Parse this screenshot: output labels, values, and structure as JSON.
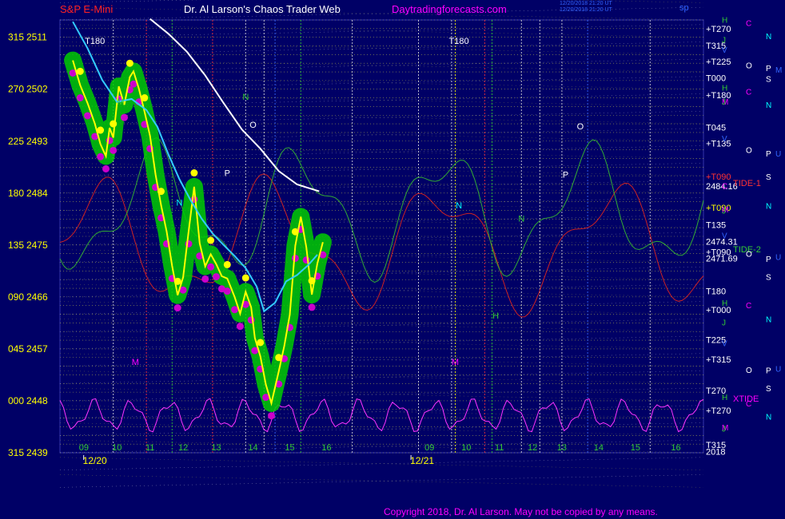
{
  "header": {
    "symbol": "S&P E-Mini",
    "site_title": "Dr. Al Larson's Chaos Trader Web",
    "site_url": "Daytradingforecasts.com",
    "timestamp_line1": "12/20/2018 21:20 UT",
    "timestamp_line2": "12/20/2018 21:20 UT",
    "sp_label": "sp            "
  },
  "copyright": "Copyright 2018, Dr. Al Larson. May not be copied by any means.",
  "colors": {
    "background": "#000066",
    "price_main": "#FFFF00",
    "price_glow": "#00CC00",
    "low_dots": "#CC00CC",
    "moving_avg": "#33CCFF",
    "white_line": "#FFFFFF",
    "green_line": "#33AA33",
    "red_line": "#CC2222",
    "magenta_line": "#FF33FF",
    "grid_yellow": "#CCCC44",
    "grid_white": "#DDDDDD",
    "text_yellow": "#FFFF00",
    "text_red": "#FF2222",
    "text_magenta": "#FF00FF",
    "text_cyan": "#00FFFF",
    "text_blue": "#3366FF",
    "text_green": "#33CC33"
  },
  "chart_data": {
    "type": "line",
    "title": "S&P E-Mini",
    "ylim": [
      2439,
      2514
    ],
    "y_ticks": [
      {
        "value": 2511,
        "angle": "315"
      },
      {
        "value": 2502,
        "angle": "270"
      },
      {
        "value": 2493,
        "angle": "225"
      },
      {
        "value": 2484,
        "angle": "180"
      },
      {
        "value": 2475,
        "angle": "135"
      },
      {
        "value": 2466,
        "angle": "090"
      },
      {
        "value": 2457,
        "angle": "045"
      },
      {
        "value": 2448,
        "angle": "000"
      },
      {
        "value": 2439,
        "angle": "315"
      }
    ],
    "x_hours": [
      "09",
      "10",
      "11",
      "12",
      "13",
      "14",
      "15",
      "16",
      "09",
      "10",
      "11",
      "12",
      "13",
      "14",
      "15",
      "16"
    ],
    "x_dates": [
      "12/20",
      "12/21"
    ],
    "right_labels": [
      {
        "text": "+T270",
        "price": 2512.5,
        "color": "#FFFFFF"
      },
      {
        "text": "T315",
        "price": 2509.6,
        "color": "#FFFFFF"
      },
      {
        "text": "+T225",
        "price": 2506.8,
        "color": "#FFFFFF"
      },
      {
        "text": "T000",
        "price": 2504.0,
        "color": "#FFFFFF"
      },
      {
        "text": "+T180",
        "price": 2501.0,
        "color": "#FFFFFF"
      },
      {
        "text": "T045",
        "price": 2495.4,
        "color": "#FFFFFF"
      },
      {
        "text": "+T135",
        "price": 2492.6,
        "color": "#FFFFFF"
      },
      {
        "text": "+T090",
        "price": 2486.9,
        "color": "#FF3333"
      },
      {
        "text": "2484.16",
        "price": 2485.2,
        "color": "#FFFFFF"
      },
      {
        "text": "+T090",
        "price": 2481.5,
        "color": "#FFFF00"
      },
      {
        "text": "T135",
        "price": 2478.5,
        "color": "#FFFFFF"
      },
      {
        "text": "2474.31",
        "price": 2475.6,
        "color": "#FFFFFF"
      },
      {
        "text": "+T090",
        "price": 2473.8,
        "color": "#FFFFFF"
      },
      {
        "text": "2471.69",
        "price": 2472.7,
        "color": "#FFFFFF"
      },
      {
        "text": "T180",
        "price": 2467.0,
        "color": "#FFFFFF"
      },
      {
        "text": "+T000",
        "price": 2463.8,
        "color": "#FFFFFF"
      },
      {
        "text": "T225",
        "price": 2458.6,
        "color": "#FFFFFF"
      },
      {
        "text": "+T315",
        "price": 2455.2,
        "color": "#FFFFFF"
      },
      {
        "text": "T270",
        "price": 2449.8,
        "color": "#FFFFFF"
      },
      {
        "text": "+T270",
        "price": 2446.3,
        "color": "#FFFFFF"
      },
      {
        "text": "T315",
        "price": 2440.4,
        "color": "#FFFFFF"
      },
      {
        "text": "2018",
        "price": 2439.2,
        "color": "#FFFFFF"
      }
    ],
    "tide_labels": [
      {
        "text": "TIDE-1",
        "price": 2485.8,
        "color": "#FF3333"
      },
      {
        "text": "TIDE-2",
        "price": 2474.3,
        "color": "#33CC33"
      },
      {
        "text": "XTIDE",
        "price": 2448.4,
        "color": "#FF00FF"
      }
    ],
    "planet_labels": [
      {
        "text": "H",
        "price": 2514.1,
        "color": "#33CC33",
        "col": 0
      },
      {
        "text": "C",
        "price": 2513.5,
        "color": "#FF00FF",
        "col": 1
      },
      {
        "text": "N",
        "price": 2511.2,
        "color": "#00FFFF",
        "col": 2
      },
      {
        "text": "J",
        "price": 2510.6,
        "color": "#33CC33",
        "col": 0
      },
      {
        "text": "V",
        "price": 2508.9,
        "color": "#3366FF",
        "col": 0
      },
      {
        "text": "O",
        "price": 2506.2,
        "color": "#FFFFFF",
        "col": 1
      },
      {
        "text": "P",
        "price": 2505.7,
        "color": "#FFFFFF",
        "col": 2
      },
      {
        "text": "M",
        "price": 2505.4,
        "color": "#3366FF",
        "col": 3
      },
      {
        "text": "S",
        "price": 2503.8,
        "color": "#FFFFFF",
        "col": 2
      },
      {
        "text": "H",
        "price": 2502.3,
        "color": "#33CC33",
        "col": 0
      },
      {
        "text": "C",
        "price": 2501.6,
        "color": "#FF00FF",
        "col": 1
      },
      {
        "text": "M",
        "price": 2499.9,
        "color": "#FF00FF",
        "col": 0
      },
      {
        "text": "J",
        "price": 2499.9,
        "color": "#33CC33",
        "col": 0
      },
      {
        "text": "N",
        "price": 2499.3,
        "color": "#00FFFF",
        "col": 2
      },
      {
        "text": "V",
        "price": 2493.5,
        "color": "#3366FF",
        "col": 0
      },
      {
        "text": "O",
        "price": 2491.5,
        "color": "#FFFFFF",
        "col": 1
      },
      {
        "text": "P",
        "price": 2490.9,
        "color": "#FFFFFF",
        "col": 2
      },
      {
        "text": "U",
        "price": 2490.9,
        "color": "#3366FF",
        "col": 3
      },
      {
        "text": "S",
        "price": 2486.9,
        "color": "#FFFFFF",
        "col": 2
      },
      {
        "text": "C",
        "price": 2485.3,
        "color": "#FF00FF",
        "col": 0
      },
      {
        "text": "N",
        "price": 2481.8,
        "color": "#00FFFF",
        "col": 2
      },
      {
        "text": "M",
        "price": 2481.2,
        "color": "#FF00FF",
        "col": 0
      },
      {
        "text": "J",
        "price": 2481.0,
        "color": "#33CC33",
        "col": 0
      },
      {
        "text": "V",
        "price": 2476.7,
        "color": "#3366FF",
        "col": 0
      },
      {
        "text": "O",
        "price": 2473.5,
        "color": "#FFFFFF",
        "col": 1
      },
      {
        "text": "U",
        "price": 2473.0,
        "color": "#3366FF",
        "col": 3
      },
      {
        "text": "P",
        "price": 2472.6,
        "color": "#FFFFFF",
        "col": 2
      },
      {
        "text": "S",
        "price": 2469.5,
        "color": "#FFFFFF",
        "col": 2
      },
      {
        "text": "H",
        "price": 2465.0,
        "color": "#33CC33",
        "col": 0
      },
      {
        "text": "C",
        "price": 2464.6,
        "color": "#FF00FF",
        "col": 1
      },
      {
        "text": "N",
        "price": 2462.2,
        "color": "#00FFFF",
        "col": 2
      },
      {
        "text": "J",
        "price": 2461.6,
        "color": "#33CC33",
        "col": 0
      },
      {
        "text": "V",
        "price": 2458.0,
        "color": "#3366FF",
        "col": 0
      },
      {
        "text": "O",
        "price": 2453.4,
        "color": "#FFFFFF",
        "col": 1
      },
      {
        "text": "P",
        "price": 2453.3,
        "color": "#FFFFFF",
        "col": 2
      },
      {
        "text": "U",
        "price": 2453.6,
        "color": "#3366FF",
        "col": 3
      },
      {
        "text": "S",
        "price": 2450.2,
        "color": "#FFFFFF",
        "col": 2
      },
      {
        "text": "H",
        "price": 2448.7,
        "color": "#33CC33",
        "col": 0
      },
      {
        "text": "C",
        "price": 2447.6,
        "color": "#FF00FF",
        "col": 1
      },
      {
        "text": "N",
        "price": 2445.3,
        "color": "#00FFFF",
        "col": 2
      },
      {
        "text": "M",
        "price": 2443.4,
        "color": "#FF00FF",
        "col": 0
      },
      {
        "text": "J",
        "price": 2443.2,
        "color": "#33CC33",
        "col": 0
      }
    ],
    "in_chart_labels": [
      {
        "text": "T180",
        "x": 9.5,
        "price": 2510.4,
        "color": "#FFFFFF"
      },
      {
        "text": "T180",
        "x": 19.4,
        "price": 2510.4,
        "color": "#FFFFFF"
      },
      {
        "text": "M",
        "x": 10.2,
        "price": 2499.9,
        "color": "#33CC33"
      },
      {
        "text": "N",
        "x": 11.8,
        "price": 2482.4,
        "color": "#00FFFF"
      },
      {
        "text": "N",
        "x": 13.6,
        "price": 2500.7,
        "color": "#33CC33"
      },
      {
        "text": "O",
        "x": 13.8,
        "price": 2495.9,
        "color": "#FFFFFF"
      },
      {
        "text": "P",
        "x": 13.1,
        "price": 2487.5,
        "color": "#FFFFFF"
      },
      {
        "text": "M",
        "x": 10.6,
        "price": 2454.8,
        "color": "#FF00FF"
      },
      {
        "text": "N",
        "x": 19.4,
        "price": 2481.9,
        "color": "#00FFFF"
      },
      {
        "text": "M",
        "x": 19.3,
        "price": 2454.8,
        "color": "#FF00FF"
      },
      {
        "text": "O",
        "x": 22.7,
        "price": 2495.6,
        "color": "#FFFFFF"
      },
      {
        "text": "P",
        "x": 22.3,
        "price": 2487.2,
        "color": "#FFFFFF"
      },
      {
        "text": "N",
        "x": 21.1,
        "price": 2479.6,
        "color": "#33CC33"
      },
      {
        "text": "H",
        "x": 20.4,
        "price": 2462.8,
        "color": "#33CC33"
      }
    ],
    "x_hour_positions": [
      9.2,
      10.1,
      11.0,
      11.9,
      12.8,
      13.8,
      14.8,
      15.8,
      18.6,
      19.6,
      20.5,
      21.4,
      22.2,
      23.2,
      24.2,
      25.3
    ],
    "x_dates_positions": [
      9.5,
      18.4
    ],
    "vertical_lines": [
      {
        "x": 10.0,
        "color": "#DDDDDD"
      },
      {
        "x": 10.9,
        "color": "#FF3333"
      },
      {
        "x": 11.6,
        "color": "#33CC33"
      },
      {
        "x": 12.7,
        "color": "#FF3333"
      },
      {
        "x": 13.6,
        "color": "#DDDDDD"
      },
      {
        "x": 14.1,
        "color": "#DDDDDD"
      },
      {
        "x": 14.4,
        "color": "#3366FF"
      },
      {
        "x": 15.1,
        "color": "#33CC33"
      },
      {
        "x": 16.5,
        "color": "#DDDDDD"
      },
      {
        "x": 18.3,
        "color": "#DDDDDD"
      },
      {
        "x": 19.2,
        "color": "#DDDDDD"
      },
      {
        "x": 19.3,
        "color": "#FFFF00"
      },
      {
        "x": 20.1,
        "color": "#FF3333"
      },
      {
        "x": 20.3,
        "color": "#33CC33"
      },
      {
        "x": 21.1,
        "color": "#DDDDDD"
      },
      {
        "x": 21.6,
        "color": "#DDDDDD"
      },
      {
        "x": 22.2,
        "color": "#DDDDDD"
      },
      {
        "x": 22.9,
        "color": "#3366FF"
      },
      {
        "x": 24.6,
        "color": "#DDDDDD"
      }
    ],
    "series": [
      {
        "name": "price",
        "x": [
          8.9,
          9.1,
          9.3,
          9.5,
          9.65,
          9.8,
          9.9,
          10.0,
          10.15,
          10.3,
          10.45,
          10.55,
          10.7,
          10.85,
          11.0,
          11.15,
          11.3,
          11.45,
          11.6,
          11.75,
          11.9,
          12.05,
          12.2,
          12.35,
          12.5,
          12.65,
          12.8,
          12.95,
          13.1,
          13.3,
          13.45,
          13.6,
          13.75,
          13.85,
          14.0,
          14.15,
          14.3,
          14.5,
          14.65,
          14.8,
          14.95,
          15.1,
          15.25,
          15.4,
          15.55,
          15.7
        ],
        "y": [
          2507.0,
          2502.7,
          2499.6,
          2496.0,
          2492.5,
          2490.4,
          2495.3,
          2493.6,
          2502.5,
          2499.3,
          2504.1,
          2505.1,
          2502.0,
          2498.1,
          2493.9,
          2487.2,
          2481.9,
          2477.4,
          2471.4,
          2466.3,
          2469.4,
          2477.4,
          2485.1,
          2475.3,
          2471.3,
          2473.4,
          2471.7,
          2469.6,
          2469.2,
          2466.0,
          2463.1,
          2466.9,
          2464.2,
          2458.9,
          2455.7,
          2450.8,
          2447.6,
          2453.1,
          2457.5,
          2462.9,
          2474.9,
          2479.9,
          2474.6,
          2466.4,
          2471.8,
          2475.5
        ]
      },
      {
        "name": "moving average",
        "x": [
          8.9,
          9.3,
          9.7,
          10.1,
          10.5,
          10.9,
          11.2,
          11.5,
          11.8,
          12.1,
          12.4,
          12.7,
          13.0,
          13.3,
          13.6,
          13.9,
          14.1,
          14.4,
          14.7,
          15.0,
          15.3,
          15.55
        ],
        "y": [
          2513.7,
          2509.1,
          2503.6,
          2499.8,
          2500.3,
          2498.4,
          2495.5,
          2490.7,
          2486.4,
          2482.8,
          2479.6,
          2477.0,
          2475.0,
          2473.1,
          2471.0,
          2467.8,
          2463.5,
          2465.0,
          2468.7,
          2469.8,
          2471.5,
          2473.3
        ]
      },
      {
        "name": "white forecast",
        "x": [
          11.0,
          11.5,
          12.0,
          12.5,
          13.0,
          13.5,
          14.0,
          14.5,
          15.0,
          15.3,
          15.6
        ],
        "y": [
          2514.2,
          2511.6,
          2508.5,
          2504.4,
          2499.6,
          2495.0,
          2491.7,
          2487.8,
          2485.5,
          2484.9,
          2484.3
        ]
      }
    ]
  }
}
